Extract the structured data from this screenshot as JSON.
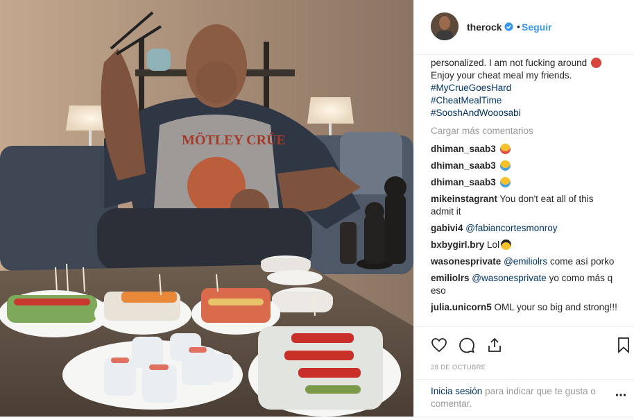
{
  "header": {
    "username": "therock",
    "follow_label": "Seguir",
    "dot": "•"
  },
  "caption": {
    "lines": [
      "personalized. I am not fucking around",
      "Enjoy your cheat meal my friends."
    ],
    "hashtags": [
      "#MyCrueGoesHard",
      "#CheatMealTime",
      "#SooshAndWooosabi"
    ]
  },
  "load_more_label": "Cargar más comentarios",
  "comments": [
    {
      "user": "dhiman_saab3",
      "text": ""
    },
    {
      "user": "dhiman_saab3",
      "text": ""
    },
    {
      "user": "dhiman_saab3",
      "text": ""
    },
    {
      "user": "mikeinstagrant",
      "text": "You don't eat all of this admit it"
    },
    {
      "user": "gabivi4",
      "mention": "@fabiancortesmonroy",
      "text": ""
    },
    {
      "user": "bxbygirl.bry",
      "text": "Lol"
    },
    {
      "user": "wasonesprivate",
      "mention": "@emiliolrs",
      "text": "come así porko"
    },
    {
      "user": "emiliolrs",
      "mention": "@wasonesprivate",
      "text": "yo como más q eso"
    },
    {
      "user": "julia.unicorn5",
      "text": "OML your so big and strong!!!"
    }
  ],
  "date": "28 DE OCTUBRE",
  "login": {
    "link": "Inicia sesión",
    "text": "para indicar que te gusta o comentar."
  },
  "icons": [
    "heart-icon",
    "comment-icon",
    "share-icon",
    "bookmark-icon",
    "more-icon",
    "verified-icon"
  ],
  "colors": {
    "link": "#3897f0",
    "hashtag": "#003569",
    "muted": "#999999"
  }
}
